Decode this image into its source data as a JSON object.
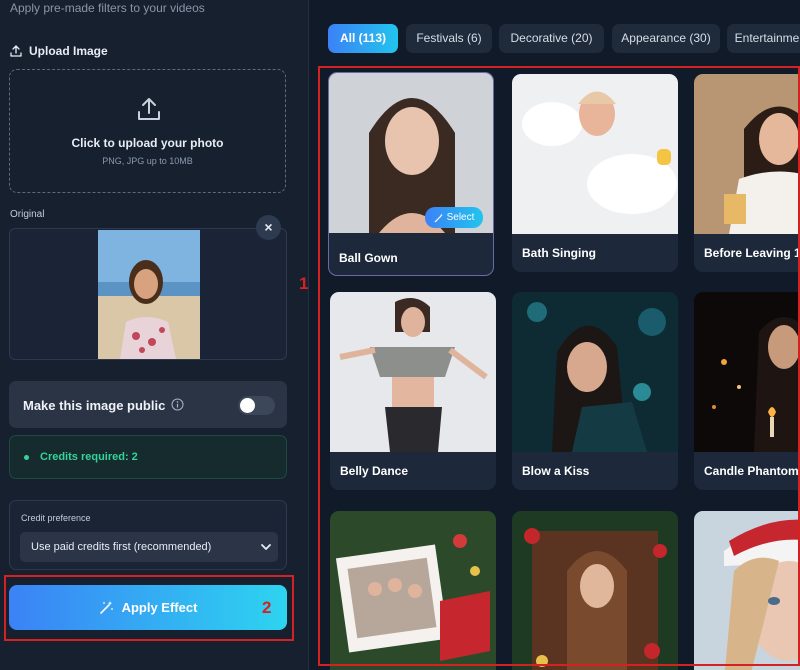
{
  "sidebar": {
    "subtitle": "Apply pre-made filters to your videos",
    "upload_label": "Upload Image",
    "dropzone_title": "Click to upload your photo",
    "dropzone_hint": "PNG, JPG up to 10MB",
    "original_label": "Original",
    "close_glyph": "×",
    "public_label": "Make this image public",
    "public_enabled": false,
    "credits_text": "Credits required: 2",
    "credit_pref_label": "Credit preference",
    "credit_pref_value": "Use paid credits first (recommended)",
    "apply_label": "Apply Effect"
  },
  "annotations": {
    "grid_marker": "1",
    "apply_marker": "2",
    "color": "#d42222"
  },
  "tabs": [
    {
      "label": "All (113)",
      "active": true
    },
    {
      "label": "Festivals (6)",
      "active": false
    },
    {
      "label": "Decorative (20)",
      "active": false
    },
    {
      "label": "Appearance (30)",
      "active": false
    },
    {
      "label": "Entertainment",
      "active": false
    }
  ],
  "effects": [
    {
      "label": "Ball Gown",
      "selected": true,
      "badge": "Select"
    },
    {
      "label": "Bath Singing",
      "selected": false
    },
    {
      "label": "Before Leaving 1",
      "selected": false
    },
    {
      "label": "Belly Dance",
      "selected": false
    },
    {
      "label": "Blow a Kiss",
      "selected": false
    },
    {
      "label": "Candle Phantom",
      "selected": false
    },
    {
      "label": "",
      "selected": false
    },
    {
      "label": "",
      "selected": false
    },
    {
      "label": "",
      "selected": false
    }
  ],
  "colors": {
    "accent_start": "#3b82f6",
    "accent_end": "#22d3ee",
    "credits_green": "#34d399",
    "background": "#121b2b"
  }
}
